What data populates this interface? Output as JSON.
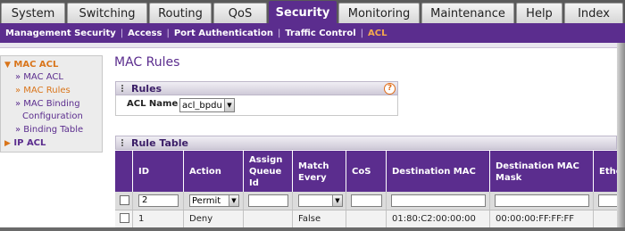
{
  "top_tabs": [
    "System",
    "Switching",
    "Routing",
    "QoS",
    "Security",
    "Monitoring",
    "Maintenance",
    "Help",
    "Index"
  ],
  "sub_nav": [
    "Management Security",
    "Access",
    "Port Authentication",
    "Traffic Control",
    "ACL"
  ],
  "left_menu": {
    "mac_acl": "MAC ACL",
    "mac_acl_sub": "» MAC ACL",
    "mac_rules": "» MAC Rules",
    "mac_binding_1": "» MAC Binding",
    "mac_binding_2": "Configuration",
    "binding_table": "» Binding Table",
    "ip_acl": "IP ACL"
  },
  "page_title": "MAC Rules",
  "rules_section": {
    "title": "Rules",
    "help": "?",
    "acl_name_label": "ACL Name",
    "acl_name_value": "acl_bpdu"
  },
  "rule_table": {
    "title": "Rule Table",
    "headers": {
      "id": "ID",
      "action": "Action",
      "assign_queue_1": "Assign",
      "assign_queue_2": "Queue",
      "assign_queue_3": "Id",
      "match_every_1": "Match",
      "match_every_2": "Every",
      "cos": "CoS",
      "dest_mac": "Destination MAC",
      "dest_mac_mask_1": "Destination MAC",
      "dest_mac_mask_2": "Mask",
      "ether": "Ether"
    },
    "input_row": {
      "id": "2",
      "action": "Permit",
      "assign_queue": "",
      "match_every": "",
      "cos": "",
      "dest_mac": "",
      "dest_mac_mask": ""
    },
    "rows": [
      {
        "id": "1",
        "action": "Deny",
        "assign_queue": "",
        "match_every": "False",
        "cos": "",
        "dest_mac": "01:80:C2:00:00:00",
        "dest_mac_mask": "00:00:00:FF:FF:FF"
      }
    ]
  }
}
